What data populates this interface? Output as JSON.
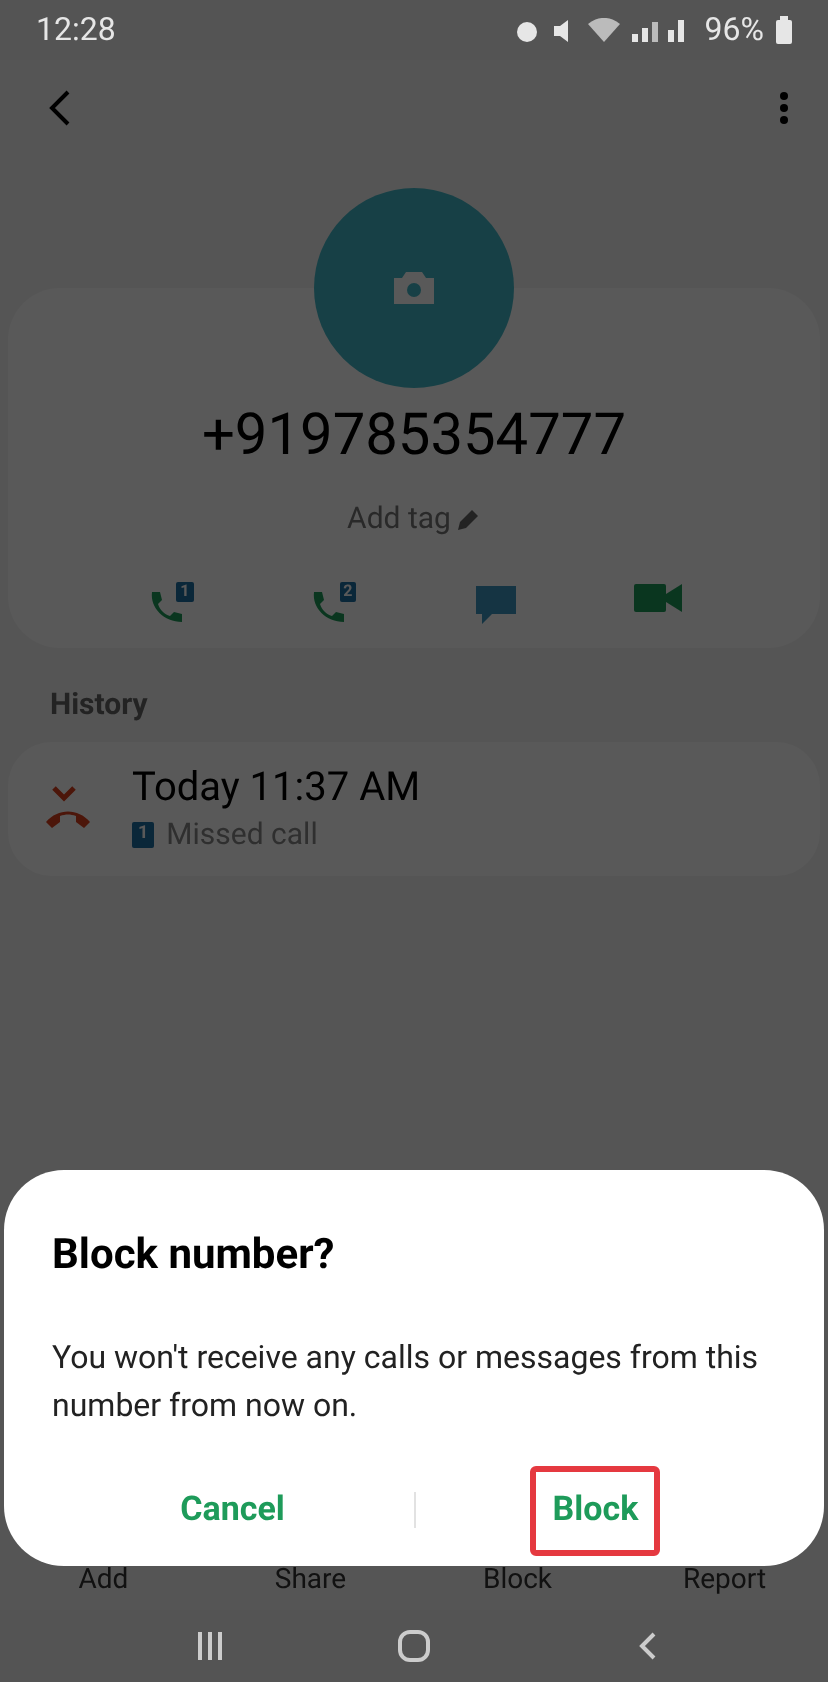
{
  "status_bar": {
    "time": "12:28",
    "battery": "96%"
  },
  "contact": {
    "number": "+919785354777",
    "tag": "Add tag"
  },
  "actions": [
    {
      "kind": "call",
      "sim": "1"
    },
    {
      "kind": "call",
      "sim": "2"
    },
    {
      "kind": "message"
    },
    {
      "kind": "video"
    }
  ],
  "history": {
    "title": "History",
    "items": [
      {
        "time": "Today 11:37 AM",
        "sim": "1",
        "type": "Missed call"
      }
    ]
  },
  "bottom_actions": [
    "Add",
    "Share",
    "Block",
    "Report"
  ],
  "dialog": {
    "title": "Block number?",
    "message": "You won't receive any calls or messages from this number from now on.",
    "buttons": [
      {
        "label": "Cancel",
        "highlighted": false
      },
      {
        "label": "Block",
        "highlighted": true
      }
    ]
  }
}
